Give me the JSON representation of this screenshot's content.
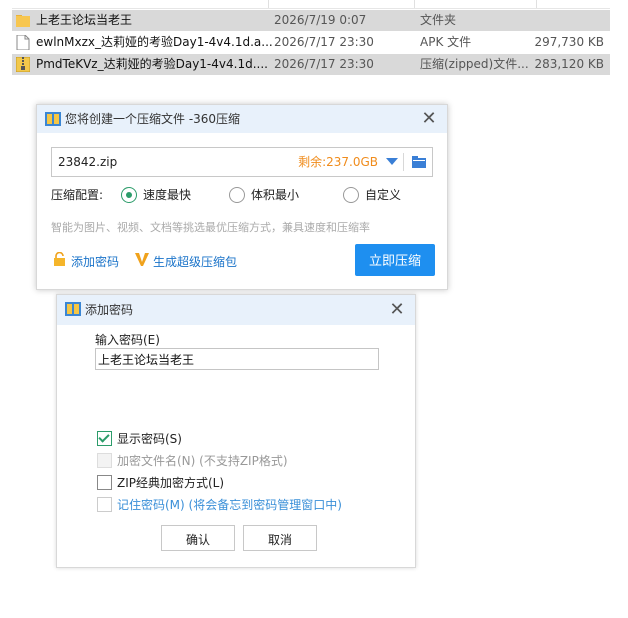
{
  "files": [
    {
      "name": "上老王论坛当老王",
      "date": "2026/7/19 0:07",
      "type": "文件夹",
      "size": "",
      "icon": "folder-icon",
      "selected": true
    },
    {
      "name": "ewlnMxzx_达莉娅的考验Day1-4v4.1d.a...",
      "date": "2026/7/17 23:30",
      "type": "APK 文件",
      "size": "297,730 KB",
      "icon": "file-icon",
      "selected": false
    },
    {
      "name": "PmdTeKVz_达莉娅的考验Day1-4v4.1d....",
      "date": "2026/7/17 23:30",
      "type": "压缩(zipped)文件...",
      "size": "283,120 KB",
      "icon": "zip-icon",
      "selected": true
    }
  ],
  "compress_dialog": {
    "title": "您将创建一个压缩文件 -360压缩",
    "path": "23842.zip",
    "free_space": "剩余:237.0GB",
    "config_label": "压缩配置:",
    "options": [
      "速度最快",
      "体积最小",
      "自定义"
    ],
    "selected_option": "速度最快",
    "hint": "智能为图片、视频、文档等挑选最优压缩方式，兼具速度和压缩率",
    "add_password": "添加密码",
    "super_zip": "生成超级压缩包",
    "compress_button": "立即压缩"
  },
  "password_dialog": {
    "title": "添加密码",
    "field_label": "输入密码(E)",
    "password_value": "上老王论坛当老王",
    "show_password": "显示密码(S)",
    "encrypt_filenames": "加密文件名(N) (不支持ZIP格式)",
    "zip_classic": "ZIP经典加密方式(L)",
    "remember_password": "记住密码(M) (将会备忘到密码管理窗口中)",
    "ok_button": "确认",
    "cancel_button": "取消"
  },
  "colors": {
    "accent": "#1e8ff0",
    "radio_on": "#2c9c6a",
    "free_space": "#f08c1c",
    "link": "#1a73c9"
  }
}
